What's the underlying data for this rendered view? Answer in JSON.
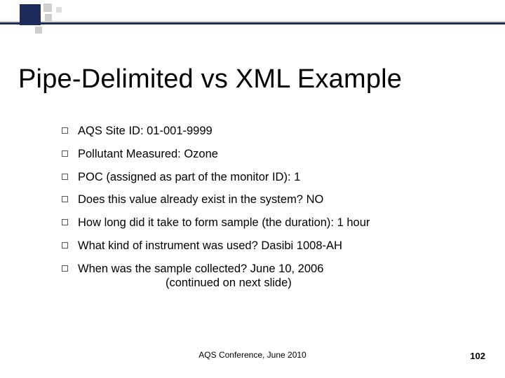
{
  "title": "Pipe-Delimited vs XML Example",
  "bullets": [
    "AQS Site ID:  01-001-9999",
    "Pollutant Measured: Ozone",
    "POC (assigned as part of the monitor ID): 1",
    "Does this value already exist in the system? NO",
    "How long did it take to form sample (the duration): 1 hour",
    "What kind of instrument was used? Dasibi 1008-AH",
    "When was the sample collected? June 10, 2006"
  ],
  "continued": "(continued on next slide)",
  "footer": "AQS Conference, June 2010",
  "page_number": "102"
}
